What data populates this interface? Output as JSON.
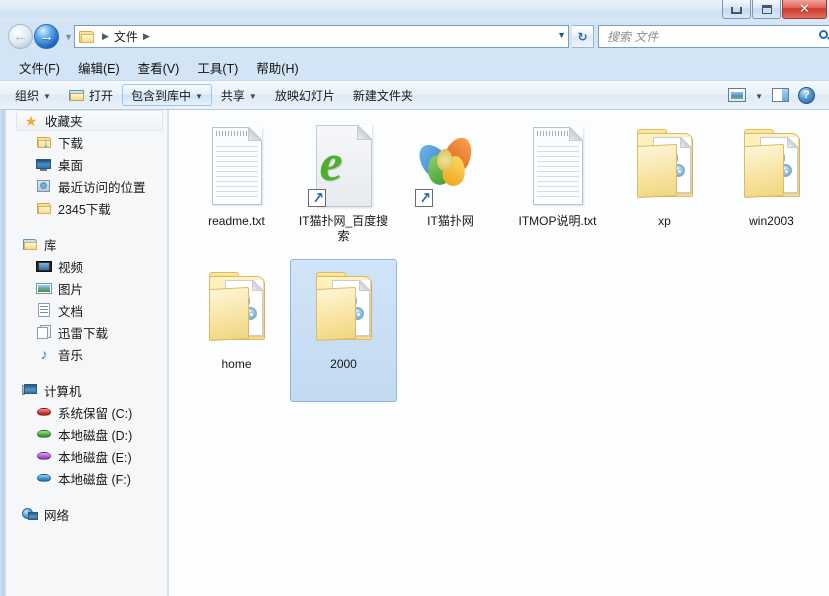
{
  "window": {
    "controls": [
      {
        "name": "minimize",
        "glyph": "–"
      },
      {
        "name": "maximize",
        "glyph": "□"
      },
      {
        "name": "close",
        "glyph": "✕"
      }
    ]
  },
  "addressbar": {
    "back_tooltip": "后退",
    "forward_tooltip": "前进",
    "crumbs": [
      "文件"
    ],
    "refresh_glyph": "↻",
    "dropdown_glyph": "▼"
  },
  "search": {
    "placeholder": "搜索 文件",
    "value": ""
  },
  "menubar": {
    "items": [
      {
        "label": "文件(F)"
      },
      {
        "label": "编辑(E)"
      },
      {
        "label": "查看(V)"
      },
      {
        "label": "工具(T)"
      },
      {
        "label": "帮助(H)"
      }
    ]
  },
  "toolbar": {
    "organize": "组织",
    "open": "打开",
    "include_in_library": "包含到库中",
    "share": "共享",
    "slideshow": "放映幻灯片",
    "new_folder": "新建文件夹",
    "caret": "▼",
    "help_glyph": "?"
  },
  "sidebar": {
    "groups": [
      {
        "header": {
          "label": "收藏夹",
          "icon": "star-icon"
        },
        "items": [
          {
            "label": "下载",
            "icon": "download-folder-icon"
          },
          {
            "label": "桌面",
            "icon": "desktop-icon"
          },
          {
            "label": "最近访问的位置",
            "icon": "recent-places-icon"
          },
          {
            "label": "2345下载",
            "icon": "folder-icon"
          }
        ]
      },
      {
        "header": {
          "label": "库",
          "icon": "library-icon"
        },
        "items": [
          {
            "label": "视频",
            "icon": "video-icon"
          },
          {
            "label": "图片",
            "icon": "pictures-icon"
          },
          {
            "label": "文档",
            "icon": "documents-icon"
          },
          {
            "label": "迅雷下载",
            "icon": "thunder-download-icon"
          },
          {
            "label": "音乐",
            "icon": "music-icon"
          }
        ]
      },
      {
        "header": {
          "label": "计算机",
          "icon": "computer-icon"
        },
        "items": [
          {
            "label": "系统保留 (C:)",
            "icon": "drive-icon",
            "color": "#d83b3b"
          },
          {
            "label": "本地磁盘 (D:)",
            "icon": "drive-icon",
            "color": "#4cb53f"
          },
          {
            "label": "本地磁盘 (E:)",
            "icon": "drive-icon",
            "color": "#b55fe0"
          },
          {
            "label": "本地磁盘 (F:)",
            "icon": "drive-icon",
            "color": "#3f95d8"
          }
        ]
      },
      {
        "header": {
          "label": "网络",
          "icon": "network-icon"
        },
        "items": []
      }
    ]
  },
  "content": {
    "items": [
      {
        "name": "readme.txt",
        "type": "textfile",
        "selected": false
      },
      {
        "name": "IT猫扑网_百度搜索",
        "type": "browser-shortcut",
        "selected": false
      },
      {
        "name": "IT猫扑网",
        "type": "butterfly-shortcut",
        "selected": false
      },
      {
        "name": "ITMOP说明.txt",
        "type": "textfile",
        "selected": false
      },
      {
        "name": "xp",
        "type": "folder",
        "selected": false
      },
      {
        "name": "win2003",
        "type": "folder",
        "selected": false
      },
      {
        "name": "home",
        "type": "folder",
        "selected": false
      },
      {
        "name": "2000",
        "type": "folder",
        "selected": true
      }
    ]
  },
  "colors": {
    "accent": "#2a6cae",
    "selection_fill": "#c9dff5",
    "selection_border": "#8cb7e2",
    "window_chrome": "#d3e4f5",
    "close_red": "#cc3a2c"
  }
}
